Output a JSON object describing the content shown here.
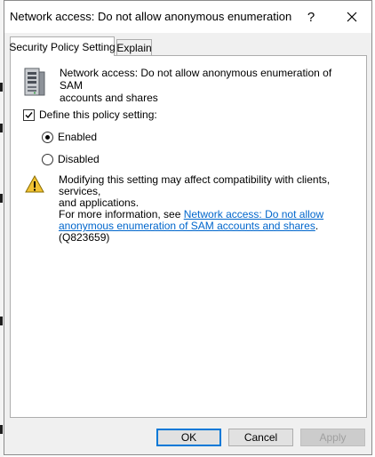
{
  "window": {
    "title": "Network access: Do not allow anonymous enumeration o...",
    "help_label": "?",
    "close_label": "✕"
  },
  "tabs": [
    {
      "label": "Security Policy Setting",
      "active": true
    },
    {
      "label": "Explain",
      "active": false
    }
  ],
  "policy": {
    "name_line1": "Network access: Do not allow anonymous enumeration of SAM",
    "name_line2": "accounts and shares",
    "icon": "server-icon"
  },
  "define_setting": {
    "label": "Define this policy setting:",
    "checked": true
  },
  "options": [
    {
      "label": "Enabled",
      "selected": true
    },
    {
      "label": "Disabled",
      "selected": false
    }
  ],
  "warning": {
    "icon": "warning-icon",
    "line1": "Modifying this setting may affect compatibility with clients, services,",
    "line2": "and applications.",
    "info_prefix": "For more information, see ",
    "link_text": "Network access: Do not allow anonymous enumeration of SAM accounts and shares",
    "info_suffix": ". (Q823659)"
  },
  "buttons": {
    "ok": "OK",
    "cancel": "Cancel",
    "apply": "Apply"
  },
  "colors": {
    "link": "#0066cc",
    "focus": "#0078d7"
  }
}
